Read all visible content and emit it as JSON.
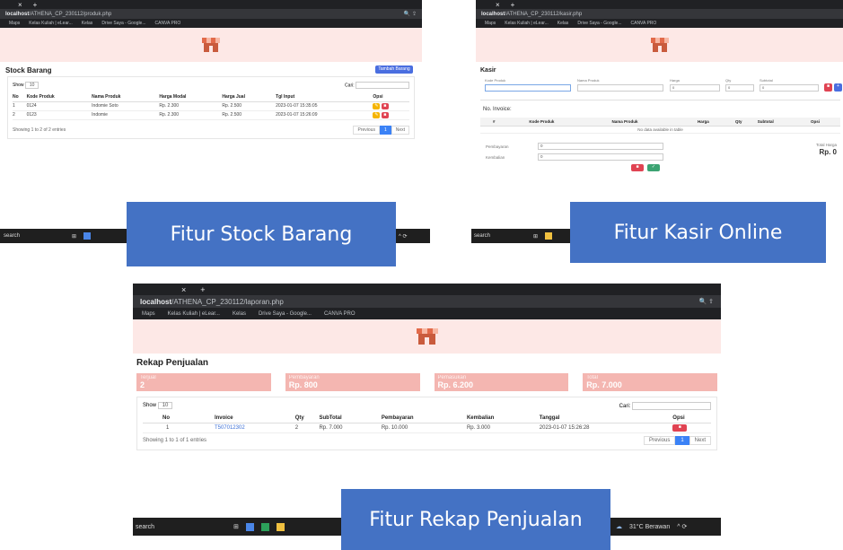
{
  "stock": {
    "tab_close": "×",
    "tab_new": "+",
    "url_host": "localhost",
    "url_path": "/ATHENA_CP_230112/produk.php",
    "bookmarks": [
      "Maps",
      "Kelas Kuliah | eLear...",
      "Kelas",
      "Drive Saya - Google...",
      "CANVA PRO"
    ],
    "title": "Stock Barang",
    "add_button": "Tambah Barang",
    "show_label": "Show",
    "show_value": "10",
    "search_label": "Cari:",
    "columns": [
      "No",
      "Kode Produk",
      "Nama Produk",
      "Harga Modal",
      "Harga Jual",
      "Tgl Input",
      "Opsi"
    ],
    "rows": [
      [
        "1",
        "0124",
        "Indomie Soto",
        "Rp. 2.300",
        "Rp. 2.500",
        "2023-01-07 15:35:05"
      ],
      [
        "2",
        "0123",
        "Indomie",
        "Rp. 2.300",
        "Rp. 2.500",
        "2023-01-07 15:26:09"
      ]
    ],
    "showing": "Showing 1 to 2 of 2 entries",
    "prev": "Previous",
    "page": "1",
    "next": "Next"
  },
  "kasir": {
    "tab_close": "×",
    "tab_new": "+",
    "url_host": "localhost",
    "url_path": "/ATHENA_CP_230112/kasir.php",
    "bookmarks": [
      "Maps",
      "Kelas Kuliah | eLear...",
      "Kelas",
      "Drive Saya - Google...",
      "CANVA PRO"
    ],
    "title": "Kasir",
    "fields": [
      "Kode Produk",
      "Nama Produk",
      "Harga",
      "Qty",
      "Subtotal"
    ],
    "field_values": [
      "",
      "",
      "0",
      "0",
      "0"
    ],
    "invoice_label": "No. Invoice:",
    "columns": [
      "#",
      "Kode Produk",
      "Nama Produk",
      "Harga",
      "Qty",
      "Subtotal",
      "Opsi"
    ],
    "empty": "No data available in table",
    "pay_label": "Pembayaran",
    "pay_value": "0",
    "change_label": "Kembalian",
    "change_value": "0",
    "total_label": "Total Harga",
    "total_value": "Rp. 0"
  },
  "rekap": {
    "tab_close": "×",
    "tab_new": "+",
    "url_host": "localhost",
    "url_path": "/ATHENA_CP_230112/laporan.php",
    "bookmarks": [
      "Maps",
      "Kelas Kuliah | eLear...",
      "Kelas",
      "Drive Saya - Google...",
      "CANVA PRO"
    ],
    "title": "Rekap Penjualan",
    "cards": [
      {
        "label": "Terjual",
        "value": "2"
      },
      {
        "label": "Pembayaran",
        "value": "Rp. 800"
      },
      {
        "label": "Pemasukan",
        "value": "Rp. 6.200"
      },
      {
        "label": "Total",
        "value": "Rp. 7.000"
      }
    ],
    "show_label": "Show",
    "show_value": "10",
    "search_label": "Cari:",
    "columns": [
      "No",
      "Invoice",
      "Qty",
      "SubTotal",
      "Pembayaran",
      "Kembalian",
      "Tanggal",
      "Opsi"
    ],
    "rows": [
      [
        "1",
        "T507012302",
        "2",
        "Rp. 7.000",
        "Rp. 10.000",
        "Rp. 3.000",
        "2023-01-07 15:26:28"
      ]
    ],
    "showing": "Showing 1 to 1 of 1 entries",
    "prev": "Previous",
    "page": "1",
    "next": "Next"
  },
  "taskbars": {
    "search": "search",
    "weather": "31°C Berawan"
  },
  "captions": {
    "stock": "Fitur Stock Barang",
    "kasir": "Fitur Kasir Online",
    "rekap": "Fitur Rekap Penjualan"
  },
  "colors": {
    "accent": "#4472c4",
    "banner": "#fde8e6",
    "card": "#f4b6b1",
    "delete": "#e04352",
    "edit": "#f5b400"
  }
}
